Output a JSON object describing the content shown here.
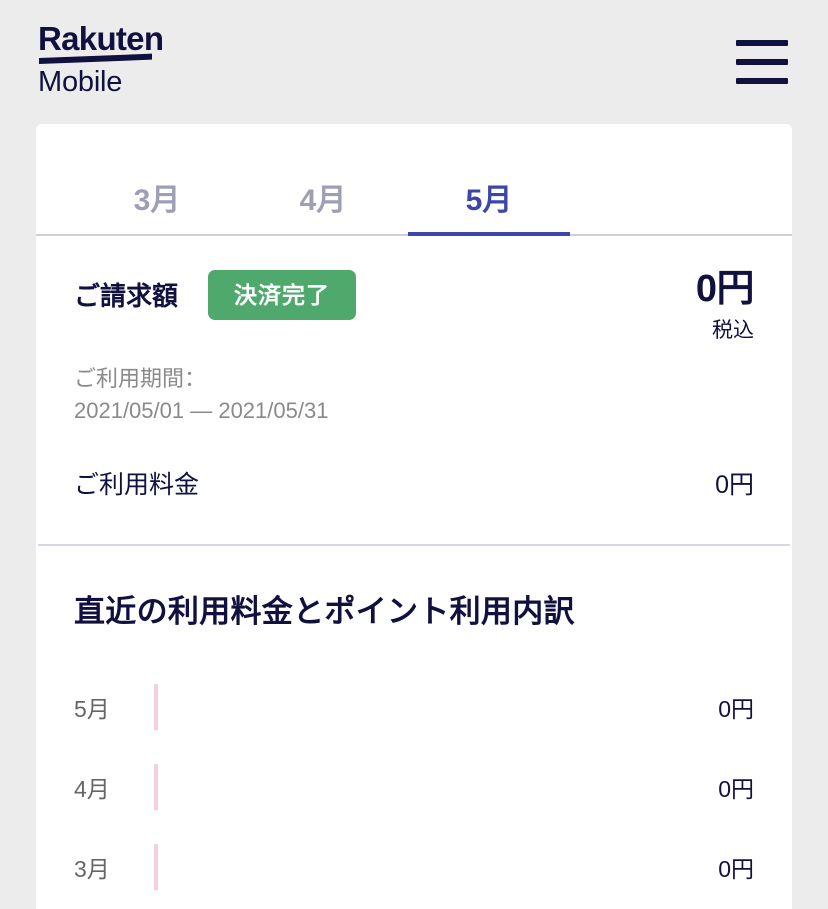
{
  "header": {
    "brand_name": "Rakuten",
    "brand_sub": "Mobile",
    "menu_icon": "hamburger-menu-icon"
  },
  "tabs": [
    {
      "label": "3月",
      "active": false
    },
    {
      "label": "4月",
      "active": false
    },
    {
      "label": "5月",
      "active": true
    }
  ],
  "billing": {
    "label": "ご請求額",
    "status_badge": "決済完了",
    "amount": "0円",
    "tax_note": "税込",
    "period_label": "ご利用期間：",
    "period_value": "2021/05/01 — 2021/05/31",
    "fee_label": "ご利用料金",
    "fee_value": "0円"
  },
  "breakdown": {
    "title": "直近の利用料金とポイント利用内訳",
    "rows": [
      {
        "month": "5月",
        "value": "0円"
      },
      {
        "month": "4月",
        "value": "0円"
      },
      {
        "month": "3月",
        "value": "0円"
      }
    ]
  },
  "colors": {
    "page_background": "#ececec",
    "brand_navy": "#11113f",
    "active_tab": "#3b46a8",
    "inactive_tab": "#9e9eb4",
    "badge_green": "#4fa96c",
    "bar_pink": "#f3cfe0",
    "muted_text": "#8a8a8a"
  },
  "chart_data": {
    "type": "bar",
    "title": "直近の利用料金とポイント利用内訳",
    "categories": [
      "5月",
      "4月",
      "3月"
    ],
    "values": [
      0,
      0,
      0
    ],
    "value_labels": [
      "0円",
      "0円",
      "0円"
    ],
    "xlabel": "",
    "ylabel": "",
    "orientation": "horizontal",
    "grid": false,
    "legend": "none",
    "bar_color": "#f3cfe0"
  }
}
